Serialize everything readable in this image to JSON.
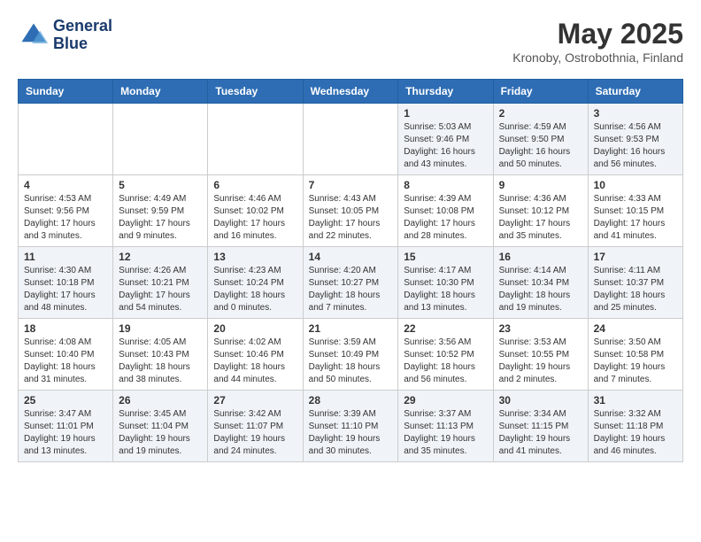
{
  "header": {
    "logo_line1": "General",
    "logo_line2": "Blue",
    "month": "May 2025",
    "location": "Kronoby, Ostrobothnia, Finland"
  },
  "weekdays": [
    "Sunday",
    "Monday",
    "Tuesday",
    "Wednesday",
    "Thursday",
    "Friday",
    "Saturday"
  ],
  "weeks": [
    [
      {
        "day": "",
        "info": ""
      },
      {
        "day": "",
        "info": ""
      },
      {
        "day": "",
        "info": ""
      },
      {
        "day": "",
        "info": ""
      },
      {
        "day": "1",
        "info": "Sunrise: 5:03 AM\nSunset: 9:46 PM\nDaylight: 16 hours\nand 43 minutes."
      },
      {
        "day": "2",
        "info": "Sunrise: 4:59 AM\nSunset: 9:50 PM\nDaylight: 16 hours\nand 50 minutes."
      },
      {
        "day": "3",
        "info": "Sunrise: 4:56 AM\nSunset: 9:53 PM\nDaylight: 16 hours\nand 56 minutes."
      }
    ],
    [
      {
        "day": "4",
        "info": "Sunrise: 4:53 AM\nSunset: 9:56 PM\nDaylight: 17 hours\nand 3 minutes."
      },
      {
        "day": "5",
        "info": "Sunrise: 4:49 AM\nSunset: 9:59 PM\nDaylight: 17 hours\nand 9 minutes."
      },
      {
        "day": "6",
        "info": "Sunrise: 4:46 AM\nSunset: 10:02 PM\nDaylight: 17 hours\nand 16 minutes."
      },
      {
        "day": "7",
        "info": "Sunrise: 4:43 AM\nSunset: 10:05 PM\nDaylight: 17 hours\nand 22 minutes."
      },
      {
        "day": "8",
        "info": "Sunrise: 4:39 AM\nSunset: 10:08 PM\nDaylight: 17 hours\nand 28 minutes."
      },
      {
        "day": "9",
        "info": "Sunrise: 4:36 AM\nSunset: 10:12 PM\nDaylight: 17 hours\nand 35 minutes."
      },
      {
        "day": "10",
        "info": "Sunrise: 4:33 AM\nSunset: 10:15 PM\nDaylight: 17 hours\nand 41 minutes."
      }
    ],
    [
      {
        "day": "11",
        "info": "Sunrise: 4:30 AM\nSunset: 10:18 PM\nDaylight: 17 hours\nand 48 minutes."
      },
      {
        "day": "12",
        "info": "Sunrise: 4:26 AM\nSunset: 10:21 PM\nDaylight: 17 hours\nand 54 minutes."
      },
      {
        "day": "13",
        "info": "Sunrise: 4:23 AM\nSunset: 10:24 PM\nDaylight: 18 hours\nand 0 minutes."
      },
      {
        "day": "14",
        "info": "Sunrise: 4:20 AM\nSunset: 10:27 PM\nDaylight: 18 hours\nand 7 minutes."
      },
      {
        "day": "15",
        "info": "Sunrise: 4:17 AM\nSunset: 10:30 PM\nDaylight: 18 hours\nand 13 minutes."
      },
      {
        "day": "16",
        "info": "Sunrise: 4:14 AM\nSunset: 10:34 PM\nDaylight: 18 hours\nand 19 minutes."
      },
      {
        "day": "17",
        "info": "Sunrise: 4:11 AM\nSunset: 10:37 PM\nDaylight: 18 hours\nand 25 minutes."
      }
    ],
    [
      {
        "day": "18",
        "info": "Sunrise: 4:08 AM\nSunset: 10:40 PM\nDaylight: 18 hours\nand 31 minutes."
      },
      {
        "day": "19",
        "info": "Sunrise: 4:05 AM\nSunset: 10:43 PM\nDaylight: 18 hours\nand 38 minutes."
      },
      {
        "day": "20",
        "info": "Sunrise: 4:02 AM\nSunset: 10:46 PM\nDaylight: 18 hours\nand 44 minutes."
      },
      {
        "day": "21",
        "info": "Sunrise: 3:59 AM\nSunset: 10:49 PM\nDaylight: 18 hours\nand 50 minutes."
      },
      {
        "day": "22",
        "info": "Sunrise: 3:56 AM\nSunset: 10:52 PM\nDaylight: 18 hours\nand 56 minutes."
      },
      {
        "day": "23",
        "info": "Sunrise: 3:53 AM\nSunset: 10:55 PM\nDaylight: 19 hours\nand 2 minutes."
      },
      {
        "day": "24",
        "info": "Sunrise: 3:50 AM\nSunset: 10:58 PM\nDaylight: 19 hours\nand 7 minutes."
      }
    ],
    [
      {
        "day": "25",
        "info": "Sunrise: 3:47 AM\nSunset: 11:01 PM\nDaylight: 19 hours\nand 13 minutes."
      },
      {
        "day": "26",
        "info": "Sunrise: 3:45 AM\nSunset: 11:04 PM\nDaylight: 19 hours\nand 19 minutes."
      },
      {
        "day": "27",
        "info": "Sunrise: 3:42 AM\nSunset: 11:07 PM\nDaylight: 19 hours\nand 24 minutes."
      },
      {
        "day": "28",
        "info": "Sunrise: 3:39 AM\nSunset: 11:10 PM\nDaylight: 19 hours\nand 30 minutes."
      },
      {
        "day": "29",
        "info": "Sunrise: 3:37 AM\nSunset: 11:13 PM\nDaylight: 19 hours\nand 35 minutes."
      },
      {
        "day": "30",
        "info": "Sunrise: 3:34 AM\nSunset: 11:15 PM\nDaylight: 19 hours\nand 41 minutes."
      },
      {
        "day": "31",
        "info": "Sunrise: 3:32 AM\nSunset: 11:18 PM\nDaylight: 19 hours\nand 46 minutes."
      }
    ]
  ]
}
